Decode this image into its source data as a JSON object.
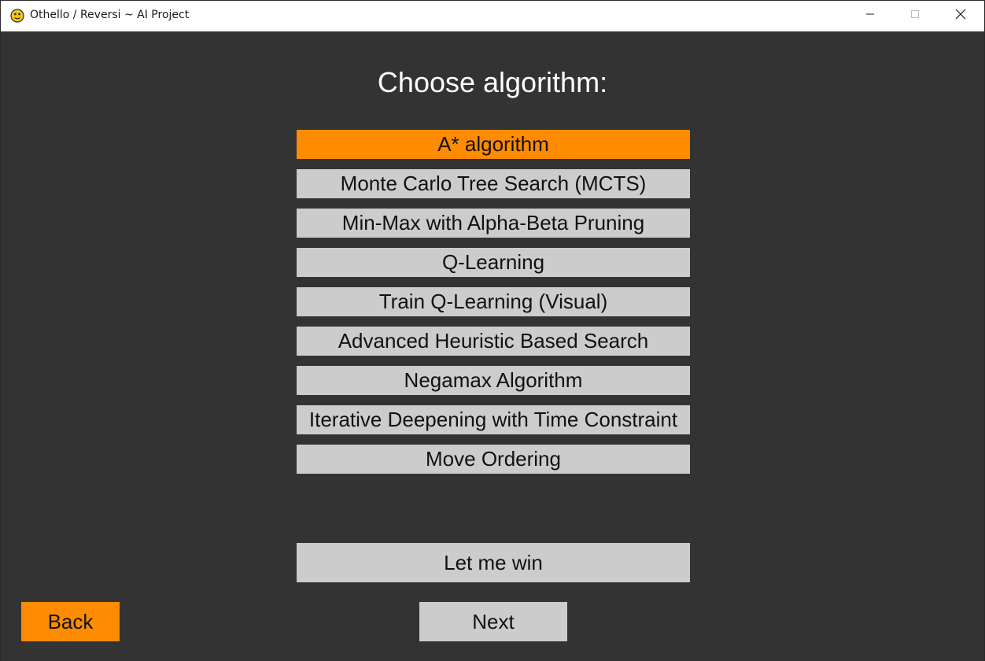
{
  "window": {
    "title": "Othello / Reversi ~ AI Project",
    "icon": "python-icon",
    "controls": [
      "minimize-icon",
      "maximize-icon",
      "close-icon"
    ]
  },
  "colors": {
    "background": "#333333",
    "button": "#cccccc",
    "selected": "#ff8c00",
    "heading_text": "#ffffff",
    "button_text": "#111111"
  },
  "heading": "Choose algorithm:",
  "algorithms": [
    {
      "label": "A* algorithm",
      "selected": true
    },
    {
      "label": "Monte Carlo Tree Search (MCTS)",
      "selected": false
    },
    {
      "label": "Min-Max with Alpha-Beta Pruning",
      "selected": false
    },
    {
      "label": "Q-Learning",
      "selected": false
    },
    {
      "label": "Train Q-Learning (Visual)",
      "selected": false
    },
    {
      "label": "Advanced Heuristic Based Search",
      "selected": false
    },
    {
      "label": "Negamax Algorithm",
      "selected": false
    },
    {
      "label": "Iterative Deepening with Time Constraint",
      "selected": false
    },
    {
      "label": "Move Ordering",
      "selected": false
    }
  ],
  "buttons": {
    "let_me_win": "Let me win",
    "back": "Back",
    "next": "Next"
  }
}
